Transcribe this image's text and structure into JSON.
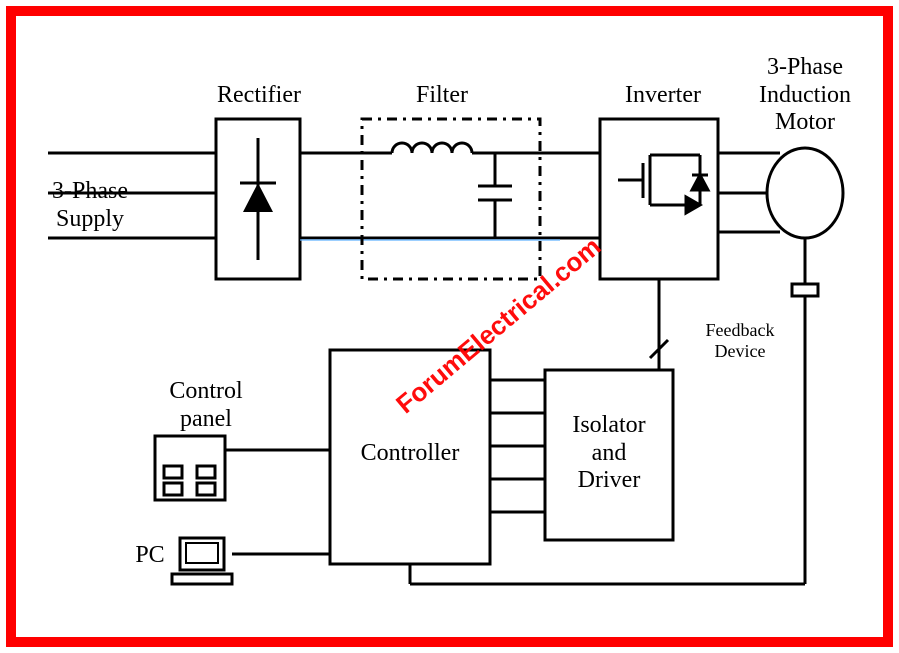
{
  "labels": {
    "supply": "3-Phase\nSupply",
    "rectifier": "Rectifier",
    "filter": "Filter",
    "inverter": "Inverter",
    "motor": "3-Phase\nInduction\nMotor",
    "control_panel": "Control\npanel",
    "controller": "Controller",
    "isolator_driver": "Isolator\nand\nDriver",
    "feedback": "Feedback\nDevice",
    "pc": "PC"
  },
  "watermark": "ForumElectrical.com"
}
